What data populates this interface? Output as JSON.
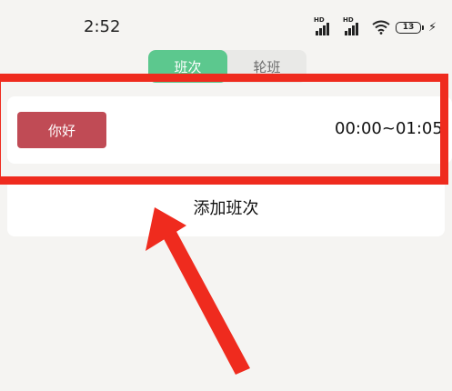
{
  "status_bar": {
    "time": "2:52",
    "signal_label": "HD",
    "battery": "13"
  },
  "tabs": [
    {
      "label": "班次",
      "active": true
    },
    {
      "label": "轮班",
      "active": false
    }
  ],
  "shift": {
    "name": "你好",
    "time": "00:00~01:05",
    "color": "#c04b55"
  },
  "add_shift_label": "添加班次",
  "colors": {
    "accent": "#5cc88e",
    "annotation": "#ef2b1e"
  }
}
